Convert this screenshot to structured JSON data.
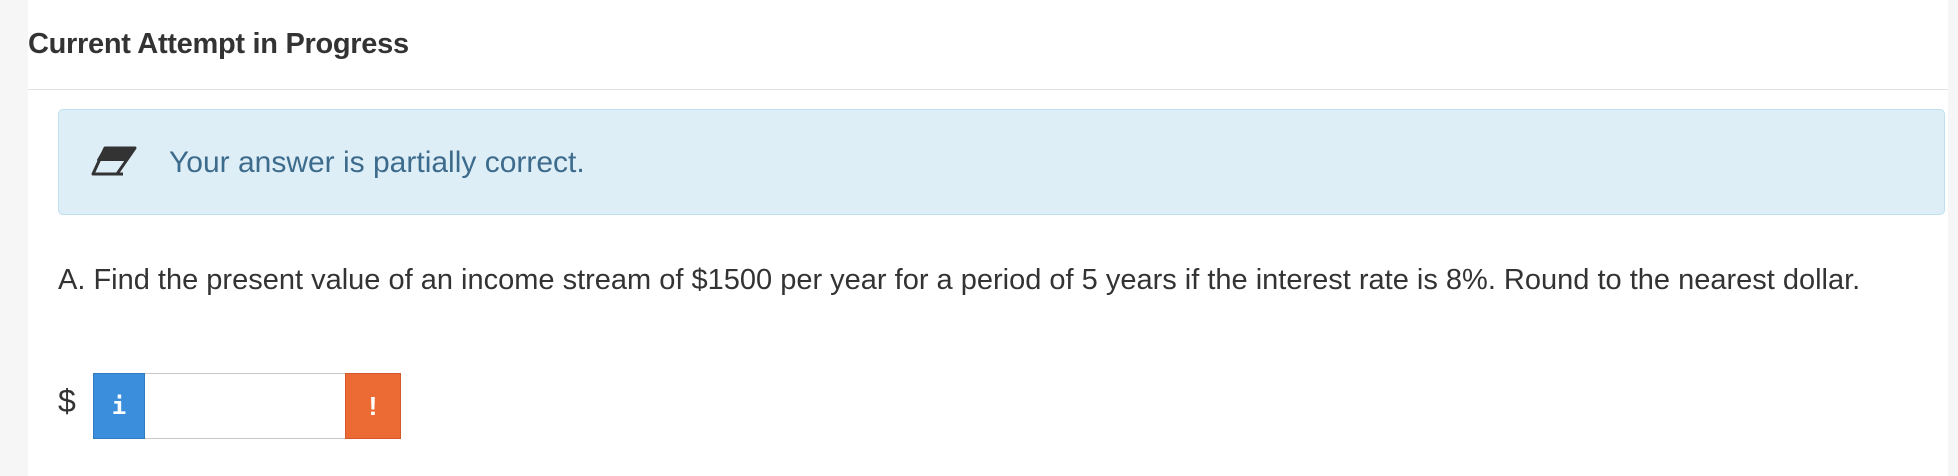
{
  "header": {
    "title": "Current Attempt in Progress"
  },
  "feedback": {
    "icon": "eraser-icon",
    "message": "Your answer is partially correct."
  },
  "question": {
    "text": "A. Find the present value of an income stream of $1500 per year for a period of 5 years if the interest rate is 8%. Round to the nearest dollar."
  },
  "answer": {
    "currency_symbol": "$",
    "info_icon_glyph": "i",
    "value": "",
    "placeholder": "",
    "warning_icon_glyph": "!"
  },
  "colors": {
    "feedback_bg": "#deeef7",
    "feedback_text": "#3d6b8c",
    "info_button": "#3b8edb",
    "warning_button": "#ec6a33"
  }
}
